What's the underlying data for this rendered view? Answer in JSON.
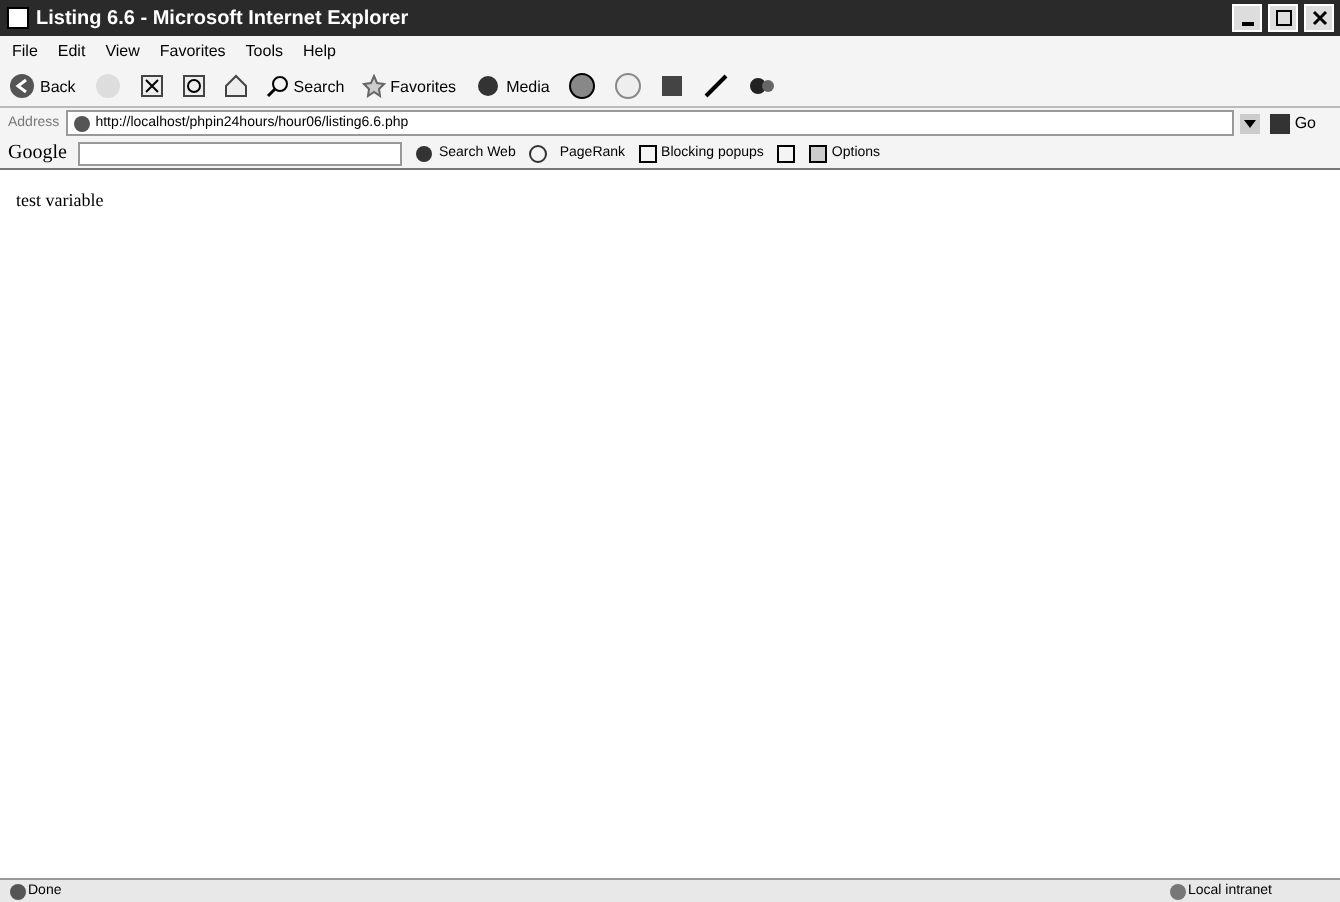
{
  "window": {
    "title": "Listing 6.6 - Microsoft Internet Explorer"
  },
  "menu": [
    "File",
    "Edit",
    "View",
    "Favorites",
    "Tools",
    "Help"
  ],
  "toolbar": {
    "back": "Back",
    "search": "Search",
    "favorites": "Favorites",
    "media": "Media"
  },
  "address": {
    "label": "Address",
    "value": "http://localhost/phpin24hours/hour06/listing6.6.php",
    "go": "Go"
  },
  "google_bar": {
    "logo": "Google",
    "search_web": "Search Web",
    "pagerank": "PageRank",
    "blocking": "Blocking popups",
    "options": "Options"
  },
  "content": {
    "text": "test variable"
  },
  "status_bar": {
    "status": "Done",
    "zone": "Local intranet"
  }
}
